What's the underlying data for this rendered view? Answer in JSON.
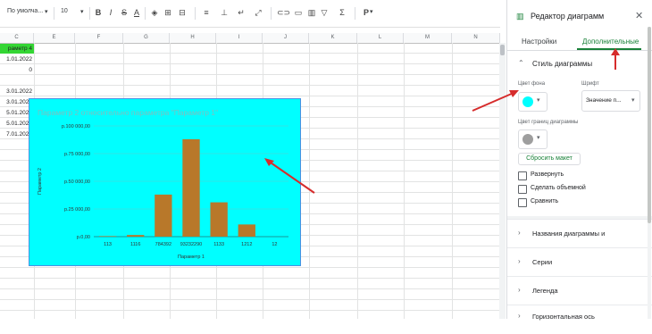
{
  "toolbar": {
    "font": "По умолча...",
    "font_size": "10",
    "currency": "Р",
    "bold": "B",
    "italic": "I",
    "strike": "S",
    "textcolor": "A",
    "sigma": "Σ"
  },
  "columns": [
    "C",
    "E",
    "F",
    "G",
    "H",
    "I",
    "J",
    "K",
    "L",
    "M",
    "N"
  ],
  "cells": [
    "раметр 4",
    "1.01.2022",
    "0",
    "",
    "3.01.2022",
    "3.01.2022",
    "5.01.2022",
    "5.01.2022",
    "7.01.2022"
  ],
  "chart_data": {
    "type": "bar",
    "title": "Параметр 2 относительно параметра \"Параметр 1\"",
    "xlabel": "Параметр 1",
    "ylabel": "Параметр 2",
    "categories": [
      "113",
      "1116",
      "784392",
      "93232290",
      "1133",
      "1212",
      "12"
    ],
    "values": [
      500,
      1500,
      38000,
      88000,
      31000,
      11000,
      0
    ],
    "y_ticks": [
      "р.0,00",
      "р.25 000,00",
      "р.50 000,00",
      "р.75 000,00",
      "р.100 000,00"
    ],
    "ylim": [
      0,
      100000
    ],
    "bar_color": "#b8782a",
    "background": "#00ffff"
  },
  "panel": {
    "title": "Редактор диаграмм",
    "tab_setup": "Настройки",
    "tab_customize": "Дополнительные",
    "section_style": "Стиль диаграммы",
    "bg_color_label": "Цвет фона",
    "font_label": "Шрифт",
    "font_value": "Значение п...",
    "border_color_label": "Цвет границ диаграммы",
    "reset_button": "Сбросить макет",
    "cb_maximize": "Развернуть",
    "cb_3d": "Сделать объемной",
    "cb_compare": "Сравнить",
    "sections": [
      "Названия диаграммы и",
      "Серии",
      "Легенда",
      "Горизонтальная ось"
    ],
    "bg_swatch": "#00ffff",
    "border_swatch": "#9e9e9e",
    "accent": "#188038"
  }
}
